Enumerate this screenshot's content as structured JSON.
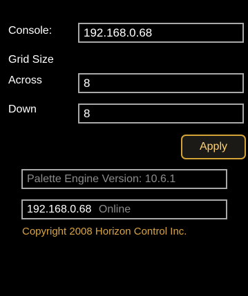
{
  "console": {
    "label": "Console:",
    "value": "192.168.0.68"
  },
  "grid": {
    "title": "Grid Size",
    "across_label": "Across",
    "across_value": "8",
    "down_label": "Down",
    "down_value": "8"
  },
  "apply_label": "Apply",
  "engine_version": "Palette Engine Version: 10.6.1",
  "status": {
    "address": "192.168.0.68",
    "state": "Online"
  },
  "copyright": "Copyright 2008 Horizon Control Inc.",
  "colors": {
    "background": "#000000",
    "field_border": "#a9a9a9",
    "accent": "#d5a437",
    "accent_text": "#ffd272",
    "muted_text": "#8c8c8c"
  }
}
